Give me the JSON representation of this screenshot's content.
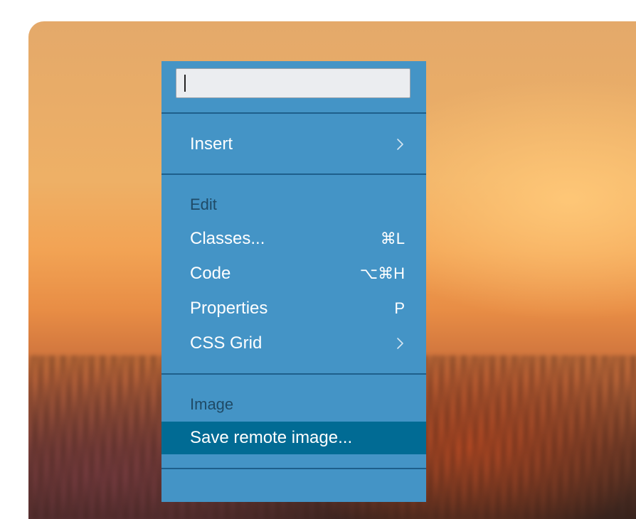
{
  "menu": {
    "search": {
      "value": "",
      "placeholder": ""
    },
    "items": {
      "insert": {
        "label": "Insert",
        "submenu_icon": "chevron-right-icon"
      },
      "classes": {
        "label": "Classes...",
        "shortcut": "⌘L"
      },
      "code": {
        "label": "Code",
        "shortcut": "⌥⌘H"
      },
      "properties": {
        "label": "Properties",
        "shortcut": "P"
      },
      "css_grid": {
        "label": "CSS Grid",
        "submenu_icon": "chevron-right-icon"
      },
      "save_remote_image": {
        "label": "Save remote image..."
      }
    },
    "sections": {
      "edit": "Edit",
      "image": "Image"
    },
    "colors": {
      "menu_bg": "#4494c6",
      "highlight_bg": "#016b94",
      "separator": "#1e5f8b",
      "section_heading": "#1f4a66",
      "text": "#ffffff"
    }
  }
}
